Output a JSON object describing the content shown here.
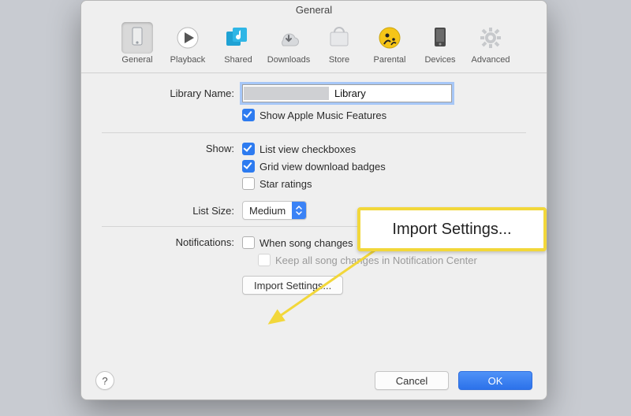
{
  "window": {
    "title": "General"
  },
  "toolbar": {
    "items": [
      {
        "label": "General"
      },
      {
        "label": "Playback"
      },
      {
        "label": "Shared"
      },
      {
        "label": "Downloads"
      },
      {
        "label": "Store"
      },
      {
        "label": "Parental"
      },
      {
        "label": "Devices"
      },
      {
        "label": "Advanced"
      }
    ]
  },
  "form": {
    "library_name_label": "Library Name:",
    "library_name_value": "Library",
    "show_apple_music": "Show Apple Music Features",
    "show_label": "Show:",
    "list_view_checkboxes": "List view checkboxes",
    "grid_view_badges": "Grid view download badges",
    "star_ratings": "Star ratings",
    "list_size_label": "List Size:",
    "list_size_value": "Medium",
    "notifications_label": "Notifications:",
    "when_song_changes": "When song changes",
    "keep_in_nc": "Keep all song changes in Notification Center",
    "import_settings": "Import Settings..."
  },
  "footer": {
    "help": "?",
    "cancel": "Cancel",
    "ok": "OK"
  },
  "callout": {
    "text": "Import Settings..."
  },
  "colors": {
    "accent": "#2d7bf0",
    "highlight": "#f2d73a"
  }
}
